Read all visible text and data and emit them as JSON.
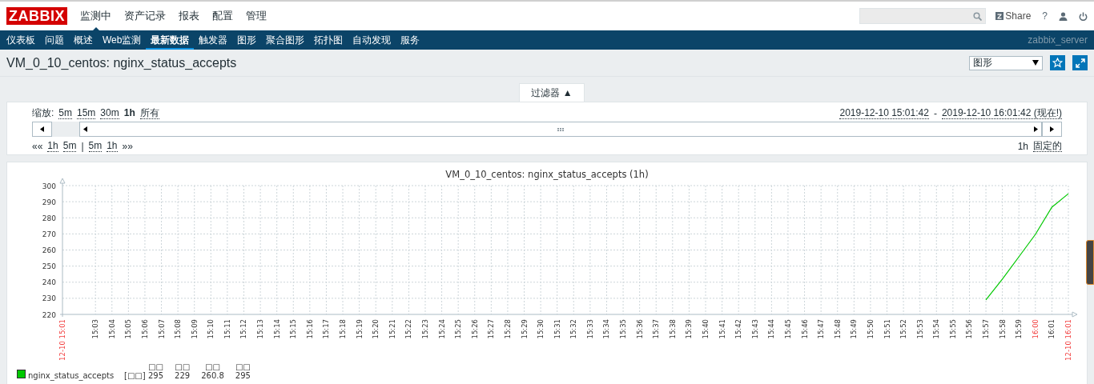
{
  "header": {
    "logo": "ZABBIX",
    "menu": [
      {
        "label": "监测中",
        "selected": true
      },
      {
        "label": "资产记录",
        "selected": false
      },
      {
        "label": "报表",
        "selected": false
      },
      {
        "label": "配置",
        "selected": false
      },
      {
        "label": "管理",
        "selected": false
      }
    ],
    "share": "Share",
    "help": "?"
  },
  "subnav": {
    "items": [
      {
        "label": "仪表板",
        "selected": false
      },
      {
        "label": "问题",
        "selected": false
      },
      {
        "label": "概述",
        "selected": false
      },
      {
        "label": "Web监测",
        "selected": false
      },
      {
        "label": "最新数据",
        "selected": true
      },
      {
        "label": "触发器",
        "selected": false
      },
      {
        "label": "图形",
        "selected": false
      },
      {
        "label": "聚合图形",
        "selected": false
      },
      {
        "label": "拓扑图",
        "selected": false
      },
      {
        "label": "自动发现",
        "selected": false
      },
      {
        "label": "服务",
        "selected": false
      }
    ],
    "server": "zabbix_server"
  },
  "page": {
    "title": "VM_0_10_centos: nginx_status_accepts",
    "view_select": "图形"
  },
  "filter": {
    "tab": "过滤器",
    "toggle": "▲",
    "zoom_label": "缩放:",
    "zoom_options": [
      {
        "label": "5m",
        "selected": false
      },
      {
        "label": "15m",
        "selected": false
      },
      {
        "label": "30m",
        "selected": false
      },
      {
        "label": "1h",
        "selected": true
      },
      {
        "label": "所有",
        "selected": false
      }
    ],
    "from": "2019-12-10 15:01:42",
    "separator": "-",
    "to": "2019-12-10 16:01:42 (现在!)",
    "back": "««",
    "back_links": [
      "1h",
      "5m"
    ],
    "divider": "|",
    "forward_links": [
      "5m",
      "1h"
    ],
    "forward": "»»",
    "period": "1h",
    "fixed": "固定的"
  },
  "graph": {
    "chart_data": {
      "type": "line",
      "grid": true,
      "title": "VM_0_10_centos: nginx_status_accepts (1h)",
      "ylim": [
        220,
        300
      ],
      "yticks": [
        220,
        230,
        240,
        250,
        260,
        270,
        280,
        290,
        300
      ],
      "categories": [
        "12-10 15:01",
        null,
        "15:03",
        "15:04",
        "15:05",
        "15:06",
        "15:07",
        "15:08",
        "15:09",
        "15:10",
        "15:11",
        "15:12",
        "15:13",
        "15:14",
        "15:15",
        "15:16",
        "15:17",
        "15:18",
        "15:19",
        "15:20",
        "15:21",
        "15:22",
        "15:23",
        "15:24",
        "15:25",
        "15:26",
        "15:27",
        "15:28",
        "15:29",
        "15:30",
        "15:31",
        "15:32",
        "15:33",
        "15:34",
        "15:35",
        "15:36",
        "15:37",
        "15:38",
        "15:39",
        "15:40",
        "15:41",
        "15:42",
        "15:43",
        "15:44",
        "15:45",
        "15:46",
        "15:47",
        "15:48",
        "15:49",
        "15:50",
        "15:51",
        "15:52",
        "15:53",
        "15:54",
        "15:55",
        "15:56",
        "15:57",
        "15:58",
        "15:59",
        "16:00",
        "16:01",
        "12-10 16:01"
      ],
      "series": [
        {
          "name": "nginx_status_accepts",
          "color": "#00c800",
          "values": [
            null,
            null,
            null,
            null,
            null,
            null,
            null,
            null,
            null,
            null,
            null,
            null,
            null,
            null,
            null,
            null,
            null,
            null,
            null,
            null,
            null,
            null,
            null,
            null,
            null,
            null,
            null,
            null,
            null,
            null,
            null,
            null,
            null,
            null,
            null,
            null,
            null,
            null,
            null,
            null,
            null,
            null,
            null,
            null,
            null,
            null,
            null,
            null,
            null,
            null,
            null,
            null,
            null,
            null,
            null,
            null,
            229,
            241.9,
            255.8,
            269.7,
            286.6,
            295
          ]
        }
      ]
    },
    "legend": {
      "function": "[□□]",
      "stats": [
        {
          "header": "□□",
          "value": "295"
        },
        {
          "header": "□□",
          "value": "229"
        },
        {
          "header": "□□",
          "value": "260.8"
        },
        {
          "header": "□□",
          "value": "295"
        }
      ]
    }
  }
}
